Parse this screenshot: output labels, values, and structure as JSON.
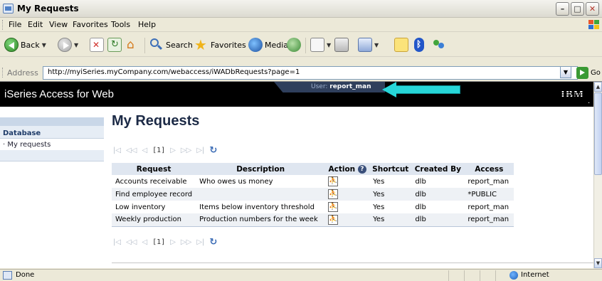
{
  "window": {
    "title": "My Requests"
  },
  "menu": {
    "items": [
      "File",
      "Edit",
      "View",
      "Favorites",
      "Tools",
      "Help"
    ]
  },
  "toolbar": {
    "back_label": "Back",
    "search_label": "Search",
    "favorites_label": "Favorites",
    "media_label": "Media"
  },
  "address": {
    "label": "Address",
    "url": "http://myiSeries.myCompany.com/webaccess/iWADbRequests?page=1",
    "go_label": "Go"
  },
  "banner": {
    "app_title": "iSeries Access for Web",
    "user_prefix": "User:",
    "user_name": "report_man",
    "logo": "IBM",
    "arrow_color": "#27d6d8"
  },
  "sidebar": {
    "section": "Database",
    "items": [
      "· My requests"
    ]
  },
  "page": {
    "title": "My Requests",
    "pager_current": "[1]"
  },
  "table": {
    "headers": [
      "Request",
      "Description",
      "Action",
      "Shortcut",
      "Created By",
      "Access"
    ],
    "rows": [
      [
        "Accounts receivable",
        "Who owes us money",
        "Yes",
        "dlb",
        "report_man"
      ],
      [
        "Find employee record",
        "",
        "Yes",
        "dlb",
        "*PUBLIC"
      ],
      [
        "Low inventory",
        "Items below inventory threshold",
        "Yes",
        "dlb",
        "report_man"
      ],
      [
        "Weekly production",
        "Production numbers for the week",
        "Yes",
        "dlb",
        "report_man"
      ]
    ]
  },
  "status": {
    "text": "Done",
    "zone": "Internet"
  }
}
